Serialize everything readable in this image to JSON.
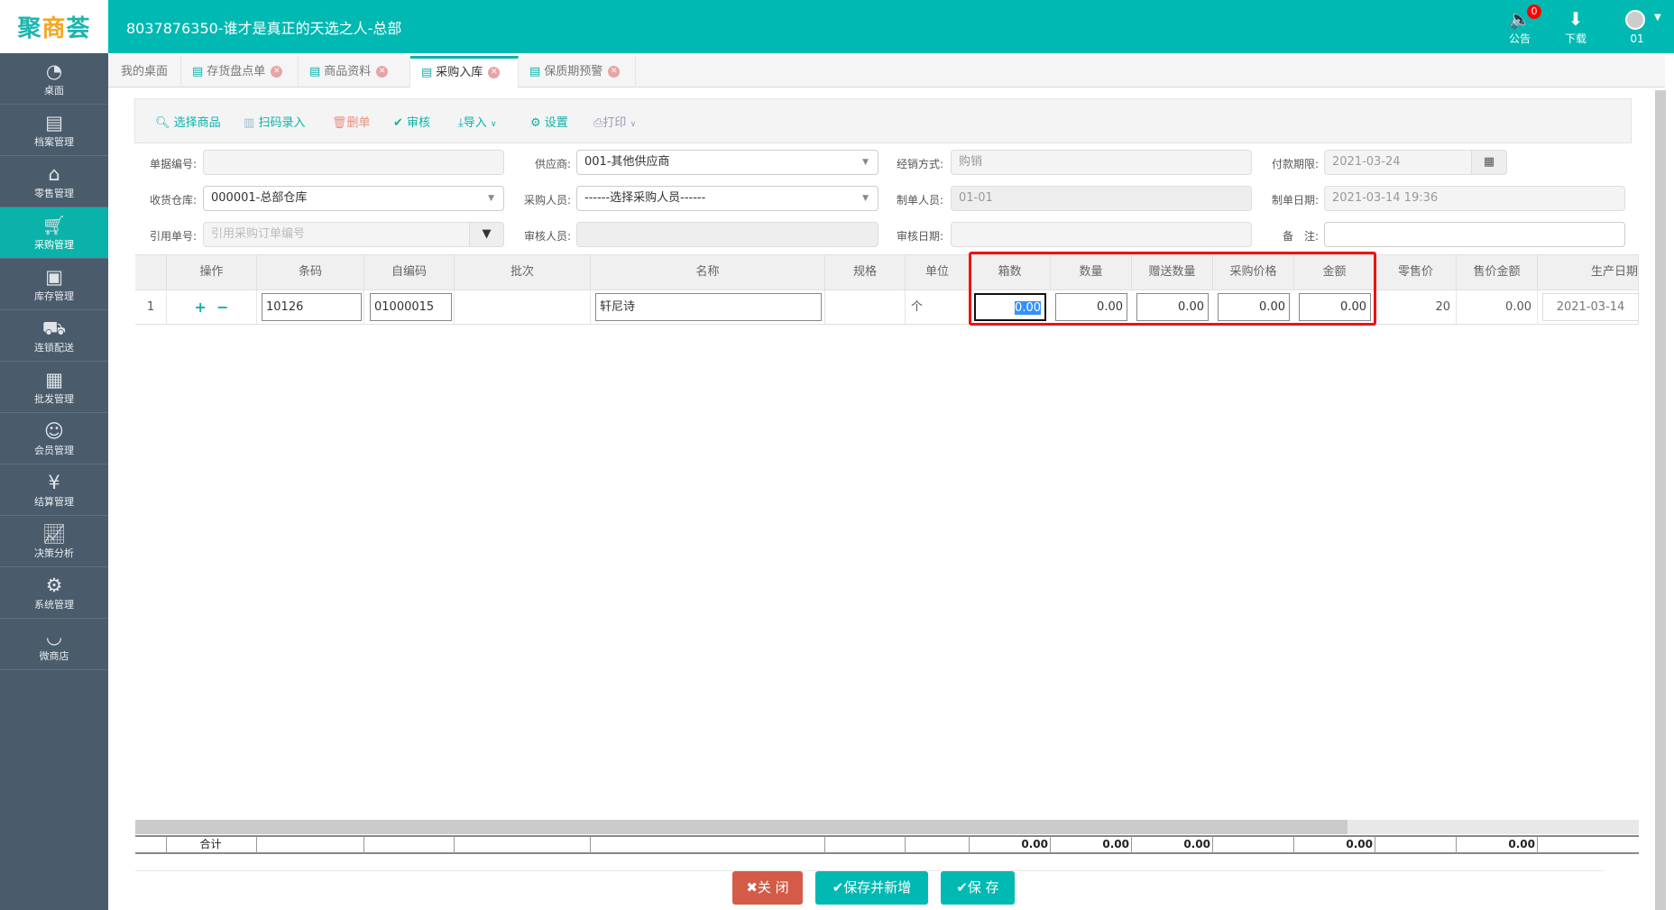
{
  "header": {
    "logo": "聚商荟",
    "title": "8037876350-谁才是真正的天选之人-总部",
    "notice_label": "公告",
    "notice_count": "0",
    "download_label": "下载",
    "user_label": "01"
  },
  "sidebar": {
    "items": [
      {
        "label": "桌面",
        "icon": "dashboard-icon"
      },
      {
        "label": "档案管理",
        "icon": "file-icon"
      },
      {
        "label": "零售管理",
        "icon": "store-icon"
      },
      {
        "label": "采购管理",
        "icon": "cart-icon"
      },
      {
        "label": "库存管理",
        "icon": "inventory-icon"
      },
      {
        "label": "连锁配送",
        "icon": "truck-icon"
      },
      {
        "label": "批发管理",
        "icon": "wholesale-icon"
      },
      {
        "label": "会员管理",
        "icon": "member-icon"
      },
      {
        "label": "结算管理",
        "icon": "yen-icon"
      },
      {
        "label": "决策分析",
        "icon": "chart-icon"
      },
      {
        "label": "系统管理",
        "icon": "gear-icon"
      },
      {
        "label": "微商店",
        "icon": "bag-icon"
      }
    ],
    "active": "采购管理"
  },
  "tabs": [
    {
      "label": "我的桌面"
    },
    {
      "label": "存货盘点单"
    },
    {
      "label": "商品资料"
    },
    {
      "label": "采购入库"
    },
    {
      "label": "保质期预警"
    }
  ],
  "toolbar": {
    "select": "选择商品",
    "scan": "扫码录入",
    "delete": "删单",
    "audit": "审核",
    "import": "导入",
    "settings": "设置",
    "print": "打印"
  },
  "form": {
    "doc_no_label": "单据编号:",
    "doc_no": "",
    "supplier_label": "供应商:",
    "supplier": "001-其他供应商",
    "sale_mode_label": "经销方式:",
    "sale_mode": "购销",
    "pay_due_label": "付款期限:",
    "pay_due": "2021-03-24",
    "warehouse_label": "收货仓库:",
    "warehouse": "000001-总部仓库",
    "buyer_label": "采购人员:",
    "buyer": "------选择采购人员------",
    "maker_label": "制单人员:",
    "maker": "01-01",
    "make_date_label": "制单日期:",
    "make_date": "2021-03-14 19:36",
    "ref_no_label": "引用单号:",
    "ref_no_placeholder": "引用采购订单编号",
    "auditor_label": "审核人员:",
    "auditor": "",
    "audit_date_label": "审核日期:",
    "audit_date": "",
    "remark_label": "备　注:",
    "remark": ""
  },
  "table": {
    "columns": [
      "操作",
      "条码",
      "自编码",
      "批次",
      "名称",
      "规格",
      "单位",
      "箱数",
      "数量",
      "赠送数量",
      "采购价格",
      "金额",
      "零售价",
      "售价金额",
      "生产日期"
    ],
    "rows": [
      {
        "index": "1",
        "barcode": "10126",
        "code": "01000015",
        "batch": "",
        "name": "轩尼诗",
        "spec": "",
        "unit": "个",
        "boxes": "0.00",
        "qty": "0.00",
        "gift_qty": "0.00",
        "price": "0.00",
        "amount": "0.00",
        "retail": "20",
        "retail_amount": "0.00",
        "prod_date": "2021-03-14"
      }
    ],
    "totals": {
      "label": "合计",
      "boxes": "0.00",
      "qty": "0.00",
      "gift_qty": "0.00",
      "amount": "0.00",
      "retail_amount": "0.00"
    }
  },
  "buttons": {
    "close": "✖关 闭",
    "save_new": "✔保存并新增",
    "save": "✔保 存"
  }
}
